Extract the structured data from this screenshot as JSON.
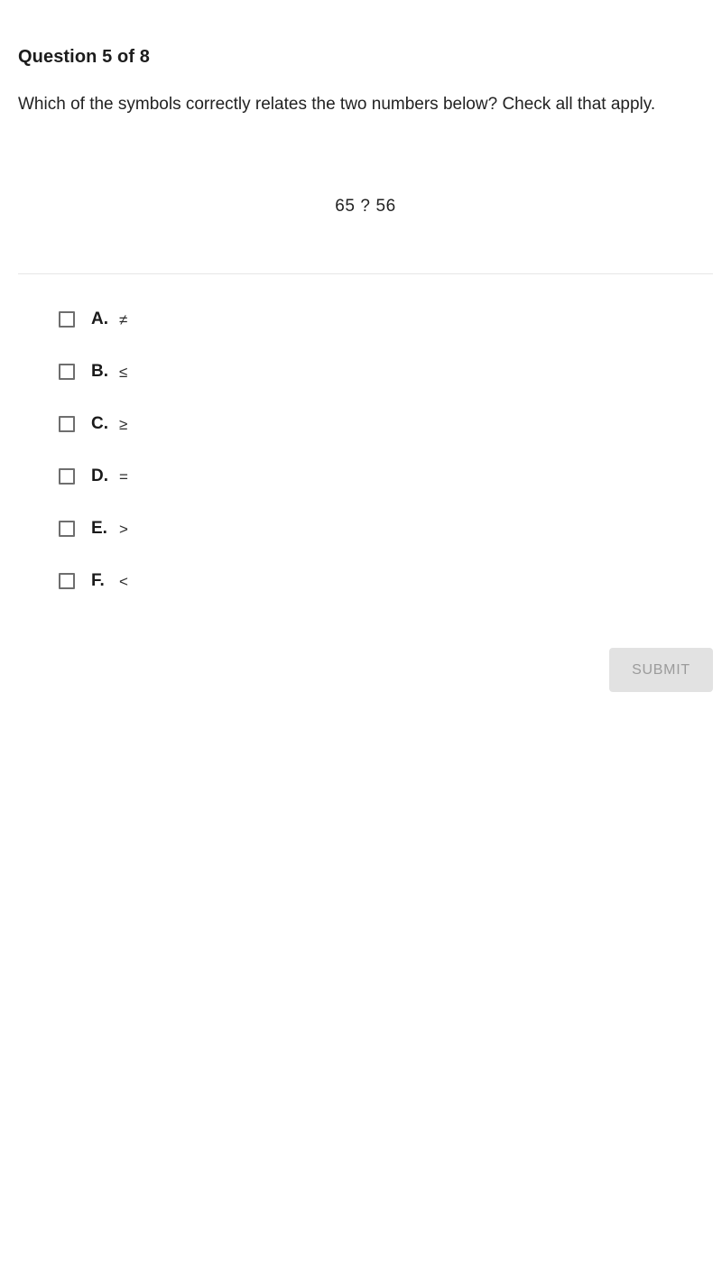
{
  "quiz": {
    "header": "Question 5 of 8",
    "prompt": "Which of the symbols correctly relates the two numbers below? Check all that apply.",
    "expression": "65 ? 56",
    "options": [
      {
        "letter": "A.",
        "symbol": "≠",
        "checked": false
      },
      {
        "letter": "B.",
        "symbol": "≤",
        "checked": false
      },
      {
        "letter": "C.",
        "symbol": "≥",
        "checked": false
      },
      {
        "letter": "D.",
        "symbol": "=",
        "checked": false
      },
      {
        "letter": "E.",
        "symbol": ">",
        "checked": false
      },
      {
        "letter": "F.",
        "symbol": "<",
        "checked": false
      }
    ],
    "submit_label": "SUBMIT"
  },
  "colors": {
    "background": "#ffffff",
    "text": "#222222",
    "heading": "#1c1c1c",
    "divider": "#e6e6e6",
    "checkbox_border": "#6e6e6e",
    "submit_background": "#e2e2e2",
    "submit_text": "#9b9b9b"
  }
}
